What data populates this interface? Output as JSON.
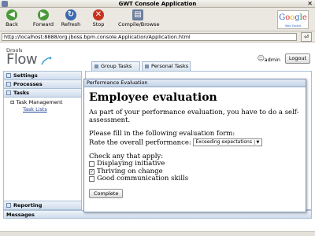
{
  "window": {
    "title": "GWT Console Application"
  },
  "toolbar": {
    "back": "Back",
    "forward": "Forward",
    "refresh": "Refresh",
    "stop": "Stop",
    "compile": "Compile/Browse",
    "google_logo": "Google",
    "google_sub": "Web Toolkit"
  },
  "address": {
    "url": "http://localhost:8888/org.jboss.bpm.console.Application/Application.html"
  },
  "header": {
    "logo_small": "Drools",
    "logo_big": "Flow",
    "username": "admin",
    "logout_label": "Logout"
  },
  "nav": {
    "settings": "Settings",
    "processes": "Processes",
    "tasks": "Tasks",
    "task_management": "Task Management",
    "task_lists": "Task Lists",
    "reporting": "Reporting"
  },
  "tabs": [
    {
      "label": "Group Tasks"
    },
    {
      "label": "Personal Tasks"
    }
  ],
  "messages_label": "Messages",
  "dialog": {
    "title": "Performance Evaluation",
    "heading": "Employee evaluation",
    "intro": "As part of your performance evaluation, you have to do a self-assessment.",
    "fill_text": "Please fill in the following evaluation form:",
    "rate_label": "Rate the overall performance:",
    "rate_value": "Exceeding expectations",
    "check_label": "Check any that apply:",
    "checks": [
      {
        "label": "Displaying initiative",
        "checked": false
      },
      {
        "label": "Thriving on change",
        "checked": true
      },
      {
        "label": "Good communication skills",
        "checked": false
      }
    ],
    "complete_label": "Complete"
  },
  "colors": {
    "accent": "#1c3f94",
    "panel_border": "#a9bfd6",
    "header_grad": "#cfdced"
  }
}
